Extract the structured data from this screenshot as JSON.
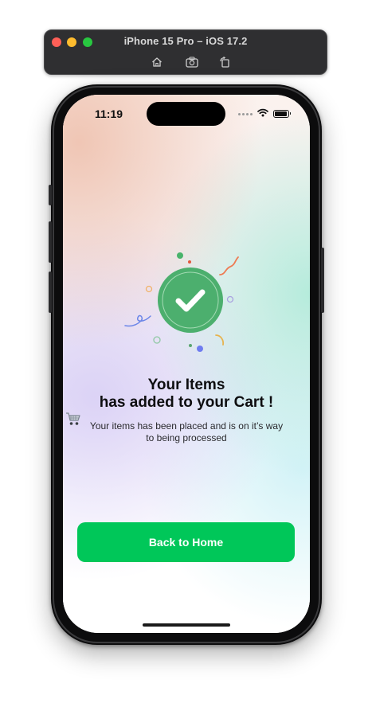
{
  "simulator": {
    "title": "iPhone 15 Pro – iOS 17.2",
    "tools": [
      "home-icon",
      "screenshot-icon",
      "rotate-icon"
    ]
  },
  "status_bar": {
    "time": "11:19",
    "icons": [
      "signal-dots-icon",
      "wifi-icon",
      "battery-icon"
    ]
  },
  "success": {
    "illustration_icon": "checkmark-badge-icon",
    "headline_line1": "Your Items",
    "headline_line2": "has added to your Cart !",
    "headline_emoji": "shopping-cart-icon",
    "message_line1": "Your items has been placed and is on it’s way",
    "message_line2": "to being processed"
  },
  "actions": {
    "back_home_label": "Back to Home"
  },
  "colors": {
    "accent_green": "#00c759",
    "badge_green": "#4caf6e"
  }
}
